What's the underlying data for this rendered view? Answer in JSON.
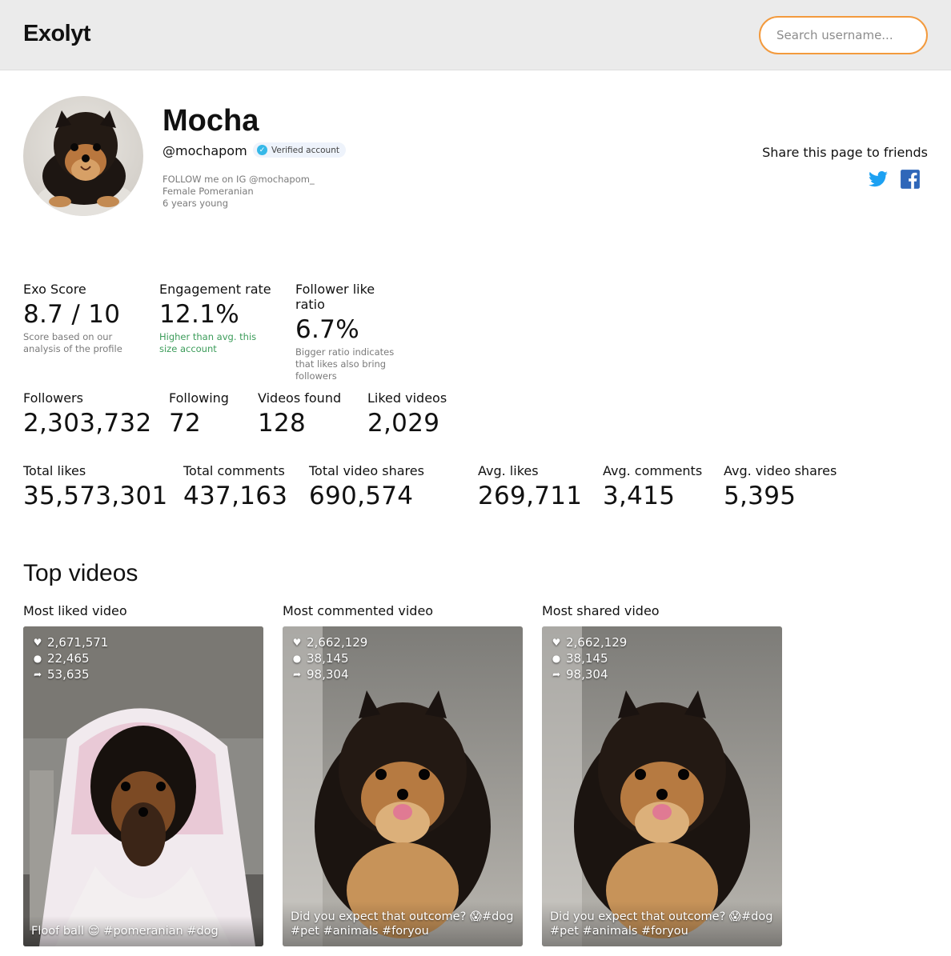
{
  "header": {
    "logo": "Exolyt",
    "search_placeholder": "Search username..."
  },
  "profile": {
    "name": "Mocha",
    "handle": "@mochapom",
    "verified_label": "Verified account",
    "bio": [
      "FOLLOW me on IG @mochapom_",
      "Female Pomeranian",
      "6 years young"
    ],
    "share_label": "Share this page to friends",
    "share_icons": [
      "twitter-icon",
      "facebook-icon"
    ]
  },
  "scores": [
    {
      "label": "Exo Score",
      "value": "8.7 / 10",
      "note": "Score based on our analysis of the profile",
      "note_style": "muted"
    },
    {
      "label": "Engagement rate",
      "value": "12.1%",
      "note": "Higher than avg. this size account",
      "note_style": "good"
    },
    {
      "label": "Follower like ratio",
      "value": "6.7%",
      "note": "Bigger ratio indicates that likes also bring followers",
      "note_style": "muted"
    }
  ],
  "counts": [
    {
      "label": "Followers",
      "value": "2,303,732"
    },
    {
      "label": "Following",
      "value": "72"
    },
    {
      "label": "Videos found",
      "value": "128"
    },
    {
      "label": "Liked videos",
      "value": "2,029"
    }
  ],
  "totals": [
    {
      "label": "Total likes",
      "value": "35,573,301"
    },
    {
      "label": "Total comments",
      "value": "437,163"
    },
    {
      "label": "Total video shares",
      "value": "690,574"
    },
    {
      "label": "Avg. likes",
      "value": "269,711"
    },
    {
      "label": "Avg. comments",
      "value": "3,415"
    },
    {
      "label": "Avg. video shares",
      "value": "5,395"
    }
  ],
  "top_videos": {
    "title": "Top videos",
    "videos": [
      {
        "label": "Most liked video",
        "likes": "2,671,571",
        "comments": "22,465",
        "shares": "53,635",
        "caption": "Floof ball 😌 #pomeranian #dog"
      },
      {
        "label": "Most commented video",
        "likes": "2,662,129",
        "comments": "38,145",
        "shares": "98,304",
        "caption": "Did you expect that outcome? 😱#dog #pet #animals #foryou"
      },
      {
        "label": "Most shared video",
        "likes": "2,662,129",
        "comments": "38,145",
        "shares": "98,304",
        "caption": "Did you expect that outcome? 😱#dog #pet #animals #foryou"
      }
    ]
  },
  "colors": {
    "accent_orange": "#f39a3d",
    "verified_blue": "#35b8e8",
    "twitter_blue": "#1da1f2",
    "facebook_blue": "#1877f2",
    "good_green": "#3c9c5a"
  }
}
